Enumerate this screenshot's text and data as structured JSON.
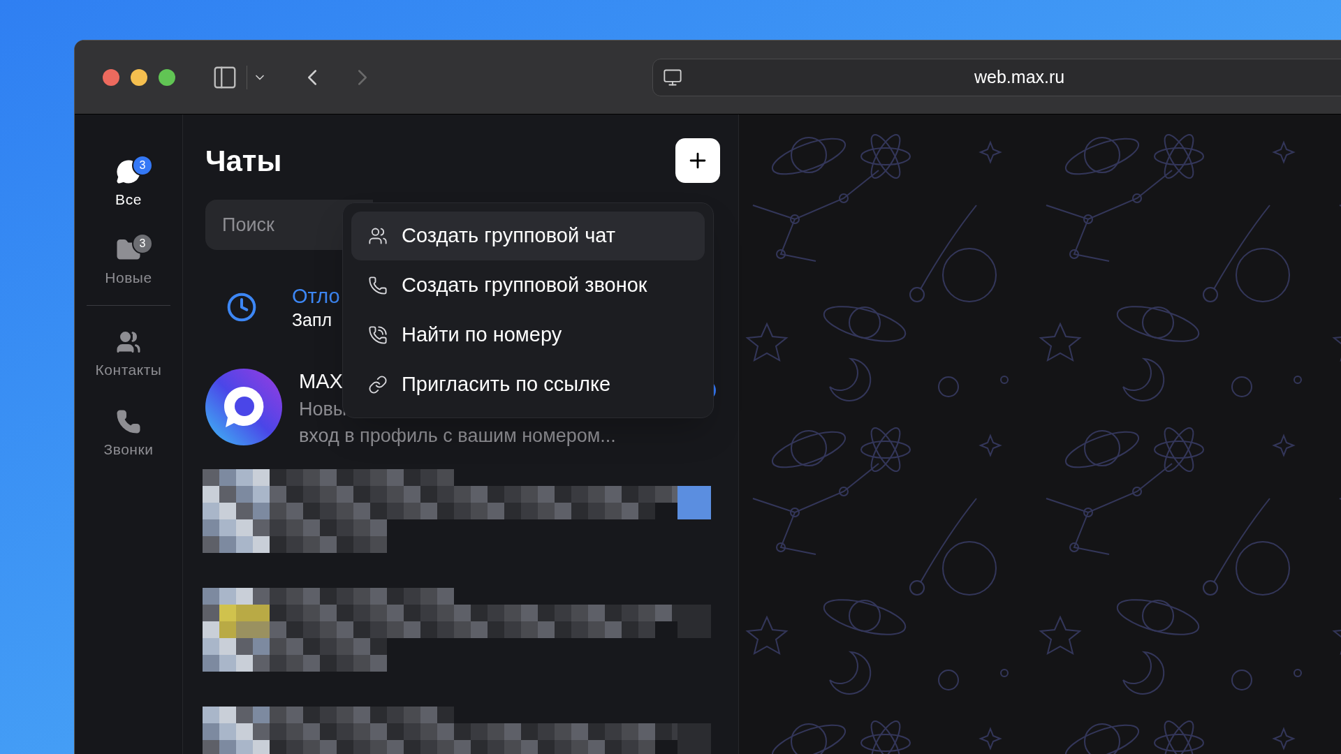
{
  "browser": {
    "url": "web.max.ru",
    "back_disabled": false,
    "forward_disabled": true
  },
  "nav": [
    {
      "label": "Все",
      "badge": "3",
      "selected": true,
      "kind": "chat"
    },
    {
      "label": "Новые",
      "badge": "3",
      "selected": false,
      "kind": "folder"
    },
    {
      "label": "Контакты",
      "selected": false,
      "kind": "contacts"
    },
    {
      "label": "Звонки",
      "selected": false,
      "kind": "calls"
    }
  ],
  "chats": {
    "title": "Чаты",
    "search": {
      "placeholder": "Поиск"
    },
    "rows": [
      {
        "kind": "scheduled",
        "name": "Отло",
        "preview": "Запл"
      },
      {
        "kind": "max",
        "name": "MAX",
        "preview": "Новы",
        "preview_line2": "вход в профиль с вашим номером...",
        "unread": true
      },
      {
        "kind": "hidden"
      },
      {
        "kind": "hidden"
      },
      {
        "kind": "hidden"
      }
    ]
  },
  "menu": [
    {
      "label": "Создать групповой чат",
      "kind": "group",
      "selected": true
    },
    {
      "label": "Создать групповой звонок",
      "kind": "call",
      "selected": false
    },
    {
      "label": "Найти по номеру",
      "kind": "dial",
      "selected": false
    },
    {
      "label": "Пригласить по ссылке",
      "kind": "link",
      "selected": false
    }
  ]
}
